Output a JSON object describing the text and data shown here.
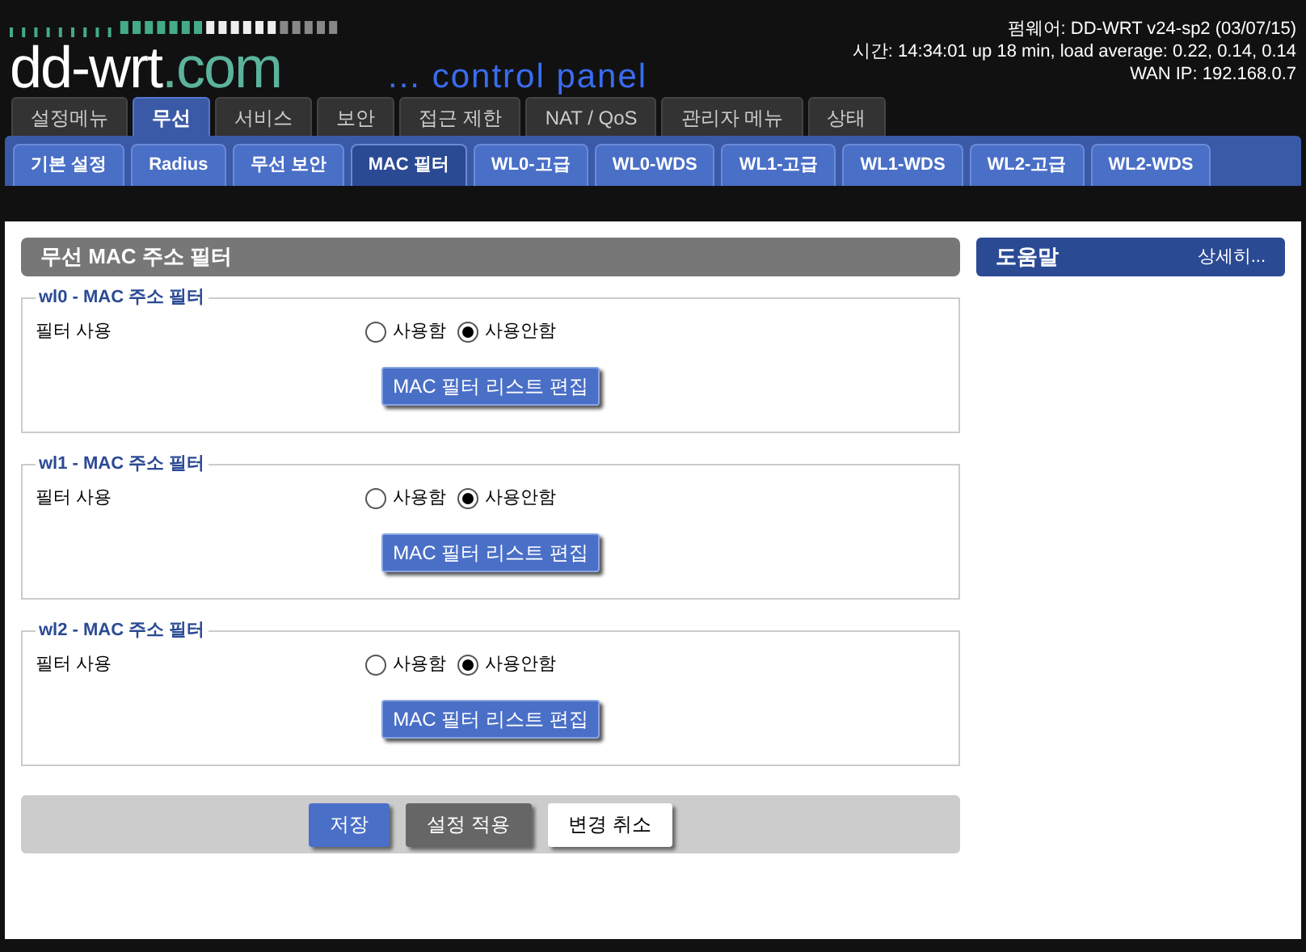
{
  "header": {
    "logo_main": "dd-wrt",
    "logo_suffix": ".com",
    "tagline": "... control panel",
    "info": [
      "펌웨어: DD-WRT v24-sp2 (03/07/15)",
      "시간: 14:34:01 up 18 min, load average: 0.22, 0.14, 0.14",
      "WAN IP: 192.168.0.7"
    ]
  },
  "main_tabs": [
    {
      "label": "설정메뉴",
      "selected": false
    },
    {
      "label": "무선",
      "selected": true
    },
    {
      "label": "서비스",
      "selected": false
    },
    {
      "label": "보안",
      "selected": false
    },
    {
      "label": "접근 제한",
      "selected": false
    },
    {
      "label": "NAT / QoS",
      "selected": false
    },
    {
      "label": "관리자 메뉴",
      "selected": false
    },
    {
      "label": "상태",
      "selected": false
    }
  ],
  "sub_tabs": [
    {
      "label": "기본 설정",
      "selected": false
    },
    {
      "label": "Radius",
      "selected": false
    },
    {
      "label": "무선 보안",
      "selected": false
    },
    {
      "label": "MAC 필터",
      "selected": true
    },
    {
      "label": "WL0-고급",
      "selected": false
    },
    {
      "label": "WL0-WDS",
      "selected": false
    },
    {
      "label": "WL1-고급",
      "selected": false
    },
    {
      "label": "WL1-WDS",
      "selected": false
    },
    {
      "label": "WL2-고급",
      "selected": false
    },
    {
      "label": "WL2-WDS",
      "selected": false
    }
  ],
  "section_title": "무선 MAC 주소 필터",
  "groups": [
    {
      "legend": "wl0 - MAC 주소 필터",
      "field_label": "필터 사용",
      "options": [
        {
          "label": "사용함",
          "selected": false
        },
        {
          "label": "사용안함",
          "selected": true
        }
      ],
      "button": "MAC 필터 리스트 편집"
    },
    {
      "legend": "wl1 - MAC 주소 필터",
      "field_label": "필터 사용",
      "options": [
        {
          "label": "사용함",
          "selected": false
        },
        {
          "label": "사용안함",
          "selected": true
        }
      ],
      "button": "MAC 필터 리스트 편집"
    },
    {
      "legend": "wl2 - MAC 주소 필터",
      "field_label": "필터 사용",
      "options": [
        {
          "label": "사용함",
          "selected": false
        },
        {
          "label": "사용안함",
          "selected": true
        }
      ],
      "button": "MAC 필터 리스트 편집"
    }
  ],
  "footer_buttons": [
    {
      "label": "저장",
      "kind": "primary"
    },
    {
      "label": "설정 적용",
      "kind": "secondary"
    },
    {
      "label": "변경 취소",
      "kind": "plain"
    }
  ],
  "help": {
    "title": "도움말",
    "link": "상세히..."
  }
}
